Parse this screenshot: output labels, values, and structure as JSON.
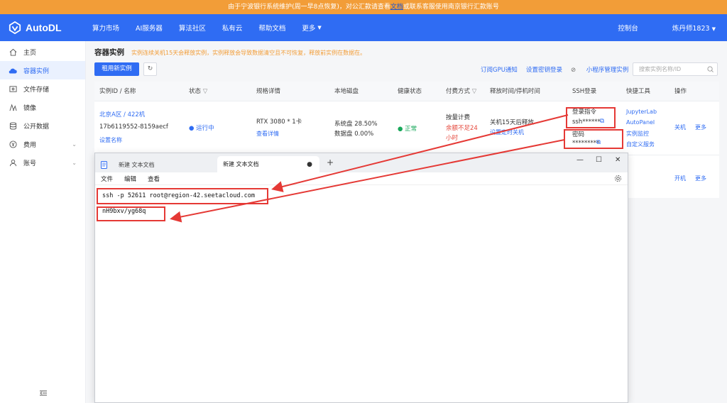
{
  "notice": {
    "part1": "由于宁波银行系统维护(周一早8点恢复)，对公汇款请查看",
    "link": "文档",
    "part2": "或联系客服使用南京银行汇款账号"
  },
  "topnav": {
    "brand": "AutoDL",
    "items": [
      "算力市场",
      "AI服务器",
      "算法社区",
      "私有云",
      "帮助文档",
      "更多"
    ],
    "console": "控制台",
    "user": "炼丹师1823"
  },
  "sidebar": {
    "items": [
      {
        "label": "主页",
        "icon": "home-icon"
      },
      {
        "label": "容器实例",
        "icon": "cloud-icon"
      },
      {
        "label": "文件存储",
        "icon": "folder-icon"
      },
      {
        "label": "镜像",
        "icon": "image-icon"
      },
      {
        "label": "公开数据",
        "icon": "database-icon"
      },
      {
        "label": "费用",
        "icon": "yen-icon"
      },
      {
        "label": "账号",
        "icon": "user-icon"
      }
    ]
  },
  "main": {
    "title": "容器实例",
    "warning": "实例连续关机15天会释放实例，实例释放会导致数据清空且不可恢复，释放前实例在数据在。",
    "rent_button": "租用新实例",
    "links": [
      "订阅GPU通知",
      "设置密钥登录",
      "小程序管理实例"
    ],
    "search_placeholder": "搜索实例名称/ID"
  },
  "table": {
    "headers": [
      "实例ID / 名称",
      "状态",
      "规格详情",
      "本地磁盘",
      "健康状态",
      "付费方式",
      "释放时间/停机时间",
      "SSH登录",
      "快捷工具",
      "操作"
    ],
    "row1": {
      "region": "北京A区 / 422机",
      "id": "17b6119552-8159aecf",
      "set_name": "设置名称",
      "status": "● 运行中",
      "gpu": "RTX 3080 * 1卡",
      "detail": "查看详情",
      "sys_disk": "系统盘 28.50%",
      "data_disk": "数据盘 0.00%",
      "health": "● 正常",
      "billing": "按量计费",
      "balance_line1": "余额不足24",
      "balance_line2": "小时",
      "release": "关机15天后释放",
      "set_shutdown": "设置定时关机",
      "ssh_cmd_label": "登录指令",
      "ssh_cmd_masked": "ssh******",
      "pwd_label": "密码",
      "pwd_masked": "*********",
      "tools": [
        "JupyterLab",
        "AutoPanel",
        "实例监控",
        "自定义服务"
      ],
      "actions": [
        "关机",
        "更多"
      ]
    },
    "row2": {
      "actions": [
        "开机",
        "更多"
      ]
    }
  },
  "notepad": {
    "tab_inactive": "新建 文本文档",
    "tab_active": "新建 文本文档",
    "menu": [
      "文件",
      "编辑",
      "查看"
    ],
    "line1": "ssh -p 52611 root@region-42.seetacloud.com",
    "line2": "nH9bxv/yg68q"
  },
  "colors": {
    "brand_blue": "#2f6cf3",
    "notice_orange": "#f29d38",
    "annotation_red": "#e53935"
  }
}
